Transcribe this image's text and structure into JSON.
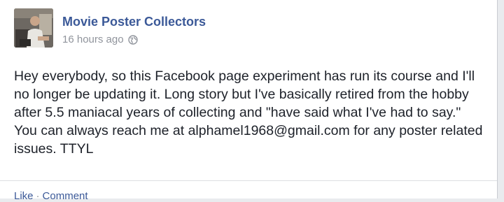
{
  "post": {
    "author": "Movie Poster Collectors",
    "timestamp": "16 hours ago",
    "privacy_icon": "globe-icon",
    "body": "Hey everybody, so this Facebook page experiment has run its course and I'll no longer be updating it. Long story but I've basically retired from the hobby after 5.5 maniacal years of collecting and \"have said what I've had to say.\" You can always reach me at alphamel1968@gmail.com for any poster related issues. TTYL"
  },
  "actions": {
    "like_label": "Like",
    "separator": "·",
    "comment_label": "Comment"
  },
  "colors": {
    "link_blue": "#3b5998",
    "meta_gray": "#90949c",
    "text": "#1d2129"
  }
}
